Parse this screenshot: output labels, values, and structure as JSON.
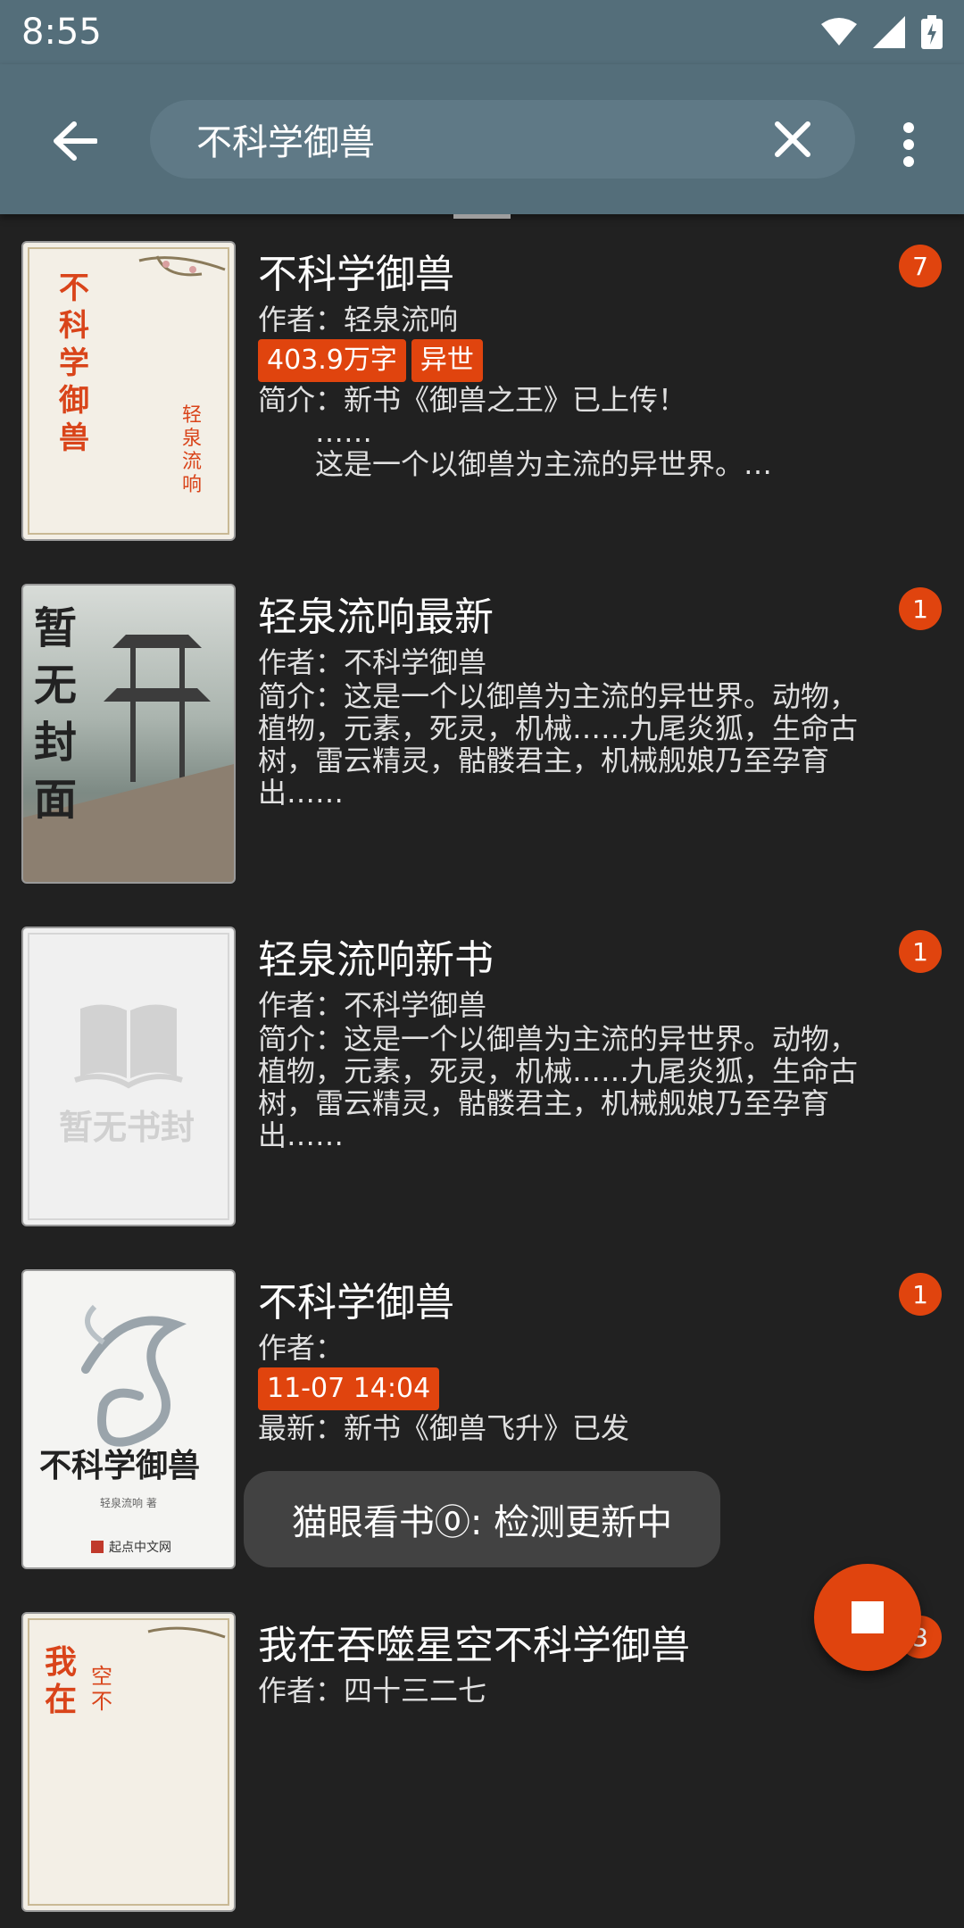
{
  "status_bar": {
    "time": "8:55"
  },
  "search": {
    "query": "不科学御兽"
  },
  "books": [
    {
      "title": "不科学御兽",
      "author": "作者：轻泉流响",
      "tags": [
        "403.9万字",
        "异世"
      ],
      "desc": "简介：新书《御兽之王》已上传！\n　　……\n　　这是一个以御兽为主流的异世界。…",
      "badge": "7",
      "cover": {
        "text_main": "不科学御兽",
        "text_side": "轻泉流响"
      }
    },
    {
      "title": "轻泉流响最新",
      "author": "作者：不科学御兽",
      "tags": [],
      "desc": "简介：这是一个以御兽为主流的异世界。动物，植物，元素，死灵，机械……九尾炎狐，生命古树，雷云精灵，骷髅君主，机械舰娘乃至孕育出……",
      "badge": "1",
      "cover": {
        "text_main": "暂无封面"
      }
    },
    {
      "title": "轻泉流响新书",
      "author": "作者：不科学御兽",
      "tags": [],
      "desc": "简介：这是一个以御兽为主流的异世界。动物，植物，元素，死灵，机械……九尾炎狐，生命古树，雷云精灵，骷髅君主，机械舰娘乃至孕育出……",
      "badge": "1",
      "cover": {
        "text_main": "暂无书封"
      }
    },
    {
      "title": "不科学御兽",
      "author": "作者：",
      "tags": [
        "11-07 14:04"
      ],
      "desc": "最新：新书《御兽飞升》已发",
      "badge": "1",
      "cover": {
        "text_main": "不科学御兽",
        "text_small": "轻泉流响 著",
        "text_publisher": "起点中文网"
      }
    },
    {
      "title": "我在吞噬星空不科学御兽",
      "author": "作者：四十三二七",
      "tags": [],
      "desc": "",
      "badge": "3",
      "cover": {
        "text_main": "我在",
        "text_side": "空不"
      }
    }
  ],
  "toast": "猫眼看书⓪: 检测更新中",
  "colors": {
    "toolbar": "#546e7a",
    "accent": "#e0440e",
    "background": "#212121"
  }
}
